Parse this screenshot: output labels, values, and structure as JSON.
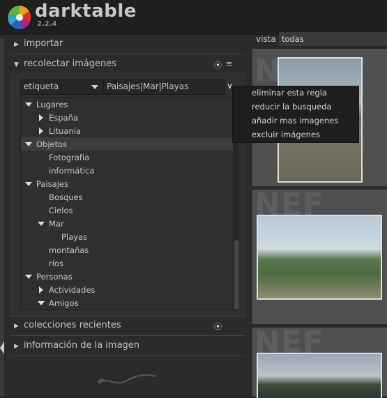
{
  "app": {
    "name": "darktable",
    "version": "2.2.4"
  },
  "left_panel": {
    "modules": [
      {
        "label": "importar"
      },
      {
        "label": "recolectar imágenes"
      },
      {
        "label": "colecciones recientes"
      },
      {
        "label": "información de la imagen"
      }
    ],
    "collect": {
      "property": "etiqueta",
      "rule_text": "Paisajes|Mar|Playas",
      "tree": [
        {
          "label": "Lugares",
          "level": 0,
          "expander": "down"
        },
        {
          "label": "España",
          "level": 1,
          "expander": "right"
        },
        {
          "label": "Lituania",
          "level": 1,
          "expander": "right"
        },
        {
          "label": "Objetos",
          "level": 0,
          "expander": "down",
          "selected": true
        },
        {
          "label": "Fotografía",
          "level": 1,
          "expander": "none"
        },
        {
          "label": "informática",
          "level": 1,
          "expander": "none"
        },
        {
          "label": "Paisajes",
          "level": 0,
          "expander": "down"
        },
        {
          "label": "Bosques",
          "level": 1,
          "expander": "none"
        },
        {
          "label": "Cielos",
          "level": 1,
          "expander": "none"
        },
        {
          "label": "Mar",
          "level": 1,
          "expander": "down"
        },
        {
          "label": "Playas",
          "level": 2,
          "expander": "none"
        },
        {
          "label": "montañas",
          "level": 1,
          "expander": "none"
        },
        {
          "label": "ríos",
          "level": 1,
          "expander": "none"
        },
        {
          "label": "Personas",
          "level": 0,
          "expander": "down"
        },
        {
          "label": "Actividades",
          "level": 1,
          "expander": "right"
        },
        {
          "label": "Amigos",
          "level": 1,
          "expander": "down"
        }
      ]
    }
  },
  "context_menu": {
    "items": [
      "eliminar esta regla",
      "reducir la busqueda",
      "añadir mas imagenes",
      "excluir imágenes"
    ]
  },
  "lighttable": {
    "vista_label": "vista",
    "vista_value": "todas",
    "thumb_badge": "NEF"
  },
  "colors": {
    "background": "#2b2b2b",
    "panel": "#303030",
    "selected_row": "#3d3d3d",
    "menu": "#1e1e1e"
  }
}
